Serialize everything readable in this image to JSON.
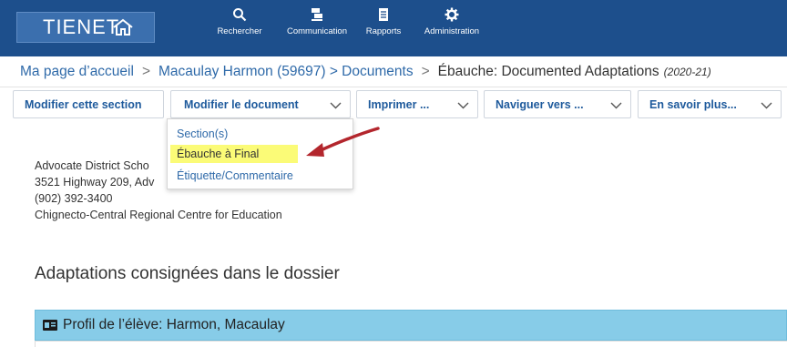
{
  "header": {
    "logo_text": "TIENET",
    "nav": [
      {
        "label": "Rechercher",
        "icon": "search-icon"
      },
      {
        "label": "Communication",
        "icon": "communication-icon"
      },
      {
        "label": "Rapports",
        "icon": "reports-icon"
      },
      {
        "label": "Administration",
        "icon": "gear-icon"
      }
    ]
  },
  "breadcrumb": {
    "home": "Ma page d’accueil",
    "student": "Macaulay Harmon (59697) > Documents",
    "current": "Ébauche: Documented Adaptations",
    "year": "(2020-21)",
    "separator": ">"
  },
  "toolbar": {
    "edit_section": "Modifier cette section",
    "edit_document": "Modifier le document",
    "print": "Imprimer ...",
    "navigate": "Naviguer vers ...",
    "learn_more": "En savoir plus..."
  },
  "dropdown": {
    "items": [
      "Section(s)",
      "Ébauche à Final",
      "Étiquette/Commentaire"
    ],
    "highlighted_index": 1,
    "highlight_color": "#fbfb77"
  },
  "address": {
    "line1": "Advocate District Scho",
    "line2": "3521 Highway 209, Adv",
    "line3": "(902) 392-3400",
    "line4": "Chignecto-Central Regional Centre for Education"
  },
  "main": {
    "heading": "Adaptations consignées dans le dossier",
    "profile_label": "Profil de l’élève: Harmon, Macaulay",
    "profile_icon": "id-card-icon"
  },
  "colors": {
    "topbar": "#1d4f8c",
    "link": "#2f6aa9",
    "profile_bar": "#87cce8",
    "arrow": "#b3262d"
  }
}
